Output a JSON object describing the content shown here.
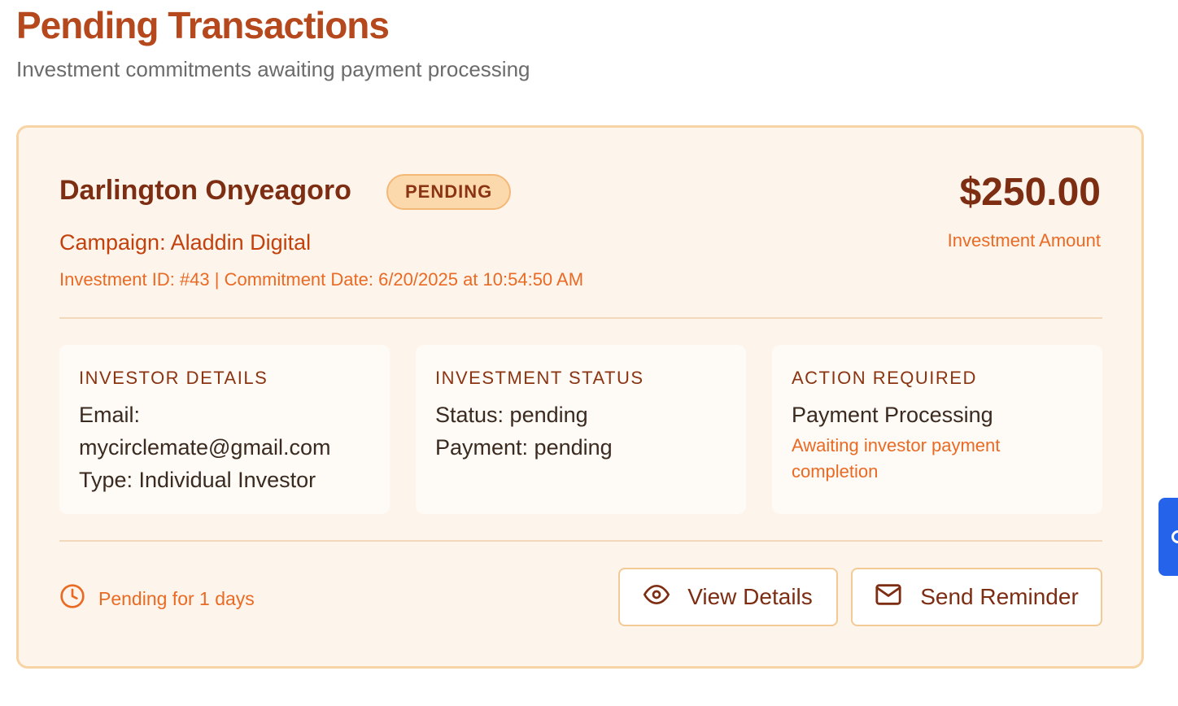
{
  "header": {
    "title": "Pending Transactions",
    "subtitle": "Investment commitments awaiting payment processing"
  },
  "transaction": {
    "investor_name": "Darlington Onyeagoro",
    "status_badge": "PENDING",
    "campaign": "Campaign: Aladdin Digital",
    "meta": "Investment ID: #43 | Commitment Date: 6/20/2025 at 10:54:50 AM",
    "amount": "$250.00",
    "amount_label": "Investment Amount",
    "investor_details": {
      "heading": "INVESTOR DETAILS",
      "email_label": "Email:",
      "email": "mycirclemate@gmail.com",
      "type": "Type: Individual Investor"
    },
    "investment_status": {
      "heading": "INVESTMENT STATUS",
      "status": "Status: pending",
      "payment": "Payment: pending"
    },
    "action_required": {
      "heading": "ACTION REQUIRED",
      "title": "Payment Processing",
      "note": "Awaiting investor payment completion"
    },
    "pending_for": "Pending for 1 days",
    "buttons": {
      "view_details": "View Details",
      "send_reminder": "Send Reminder"
    }
  },
  "icons": {
    "clock": "clock-icon",
    "eye": "eye-icon",
    "mail": "mail-icon"
  },
  "colors": {
    "brand": "#b5481d",
    "card_bg": "#fdf5ec",
    "card_border": "#f8d3a4",
    "accent_text": "#ea6a24",
    "side_tab": "#2563eb"
  }
}
